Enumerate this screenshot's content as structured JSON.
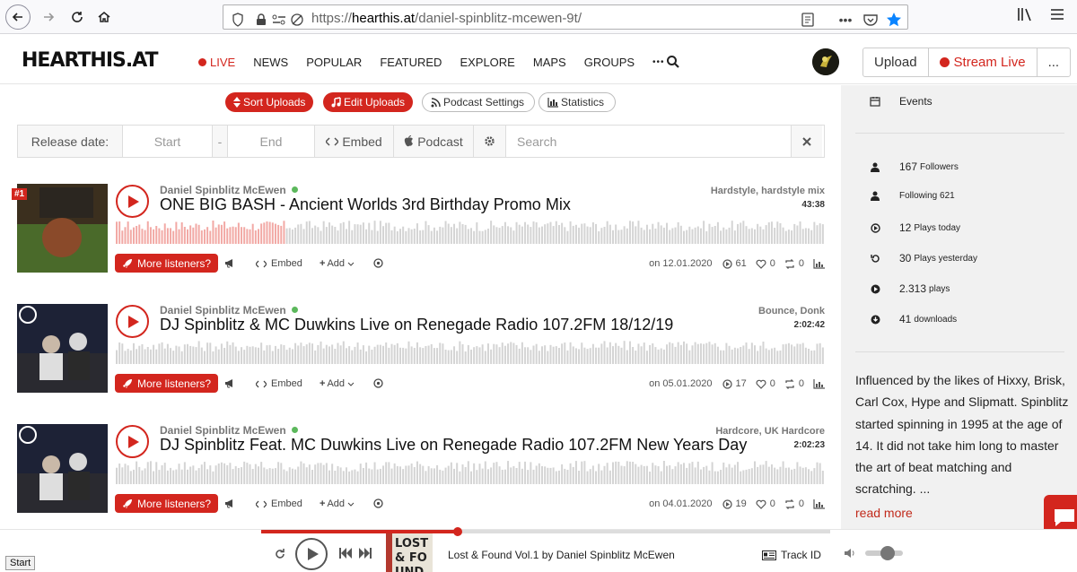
{
  "browser": {
    "url_prefix": "https://",
    "url_host": "hearthis.at",
    "url_path": "/daniel-spinblitz-mcewen-9t/"
  },
  "site": {
    "logo": "HEARTHIS.AT",
    "nav": [
      "LIVE",
      "NEWS",
      "POPULAR",
      "FEATURED",
      "EXPLORE",
      "MAPS",
      "GROUPS",
      "•••"
    ],
    "upload_label": "Upload",
    "stream_live_label": "Stream Live",
    "more_label": "...",
    "accent": "#d3261e"
  },
  "toolbar": {
    "sort_uploads": "Sort Uploads",
    "edit_uploads": "Edit Uploads",
    "podcast_settings": "Podcast Settings",
    "statistics": "Statistics"
  },
  "filter": {
    "release_date_label": "Release date:",
    "start_placeholder": "Start",
    "dash": "-",
    "end_placeholder": "End",
    "embed_label": "Embed",
    "podcast_label": "Podcast",
    "search_placeholder": "Search"
  },
  "tracks": [
    {
      "rank": "#1",
      "artist": "Daniel Spinblitz McEwen",
      "title": "ONE BIG BASH - Ancient Worlds 3rd Birthday Promo Mix",
      "genre": "Hardstyle, hardstyle mix",
      "duration": "43:38",
      "date": "on 12.01.2020",
      "plays": "61",
      "likes": "0",
      "reposts": "0",
      "played_fraction": 0.24
    },
    {
      "rank": "",
      "artist": "Daniel Spinblitz McEwen",
      "title": "DJ Spinblitz & MC Duwkins Live on Renegade Radio 107.2FM 18/12/19",
      "genre": "Bounce, Donk",
      "duration": "2:02:42",
      "date": "on 05.01.2020",
      "plays": "17",
      "likes": "0",
      "reposts": "0",
      "played_fraction": 0
    },
    {
      "rank": "",
      "artist": "Daniel Spinblitz McEwen",
      "title": "DJ Spinblitz Feat. MC Duwkins Live on Renegade Radio 107.2FM New Years Day",
      "genre": "Hardcore, UK Hardcore",
      "duration": "2:02:23",
      "date": "on 04.01.2020",
      "plays": "19",
      "likes": "0",
      "reposts": "0",
      "played_fraction": 0
    }
  ],
  "track_actions": {
    "more_listeners": "More listeners?",
    "embed": "Embed",
    "add": "Add"
  },
  "sidebar": {
    "events": "Events",
    "stats": [
      {
        "num": "167",
        "label": "Followers"
      },
      {
        "num": "",
        "label": "Following 621"
      },
      {
        "num": "12",
        "label": "Plays today"
      },
      {
        "num": "30",
        "label": "Plays yesterday"
      },
      {
        "num": "2.313",
        "label": "plays"
      },
      {
        "num": "41",
        "label": "downloads"
      }
    ],
    "bio": "Influenced by the likes of Hixxy, Brisk, Carl Cox, Hype and Slipmatt. Spinblitz started spinning in 1995 at the age of 14. It did not take him long to master the art of beat matching and scratching. ...",
    "read_more": "read more"
  },
  "player": {
    "now_playing": "Lost & Found Vol.1 by Daniel Spinblitz McEwen",
    "cover_text": "LOST & FOUND",
    "track_id": "Track ID",
    "progress": 0.345,
    "volume": 0.6
  },
  "status": {
    "start": "Start"
  }
}
